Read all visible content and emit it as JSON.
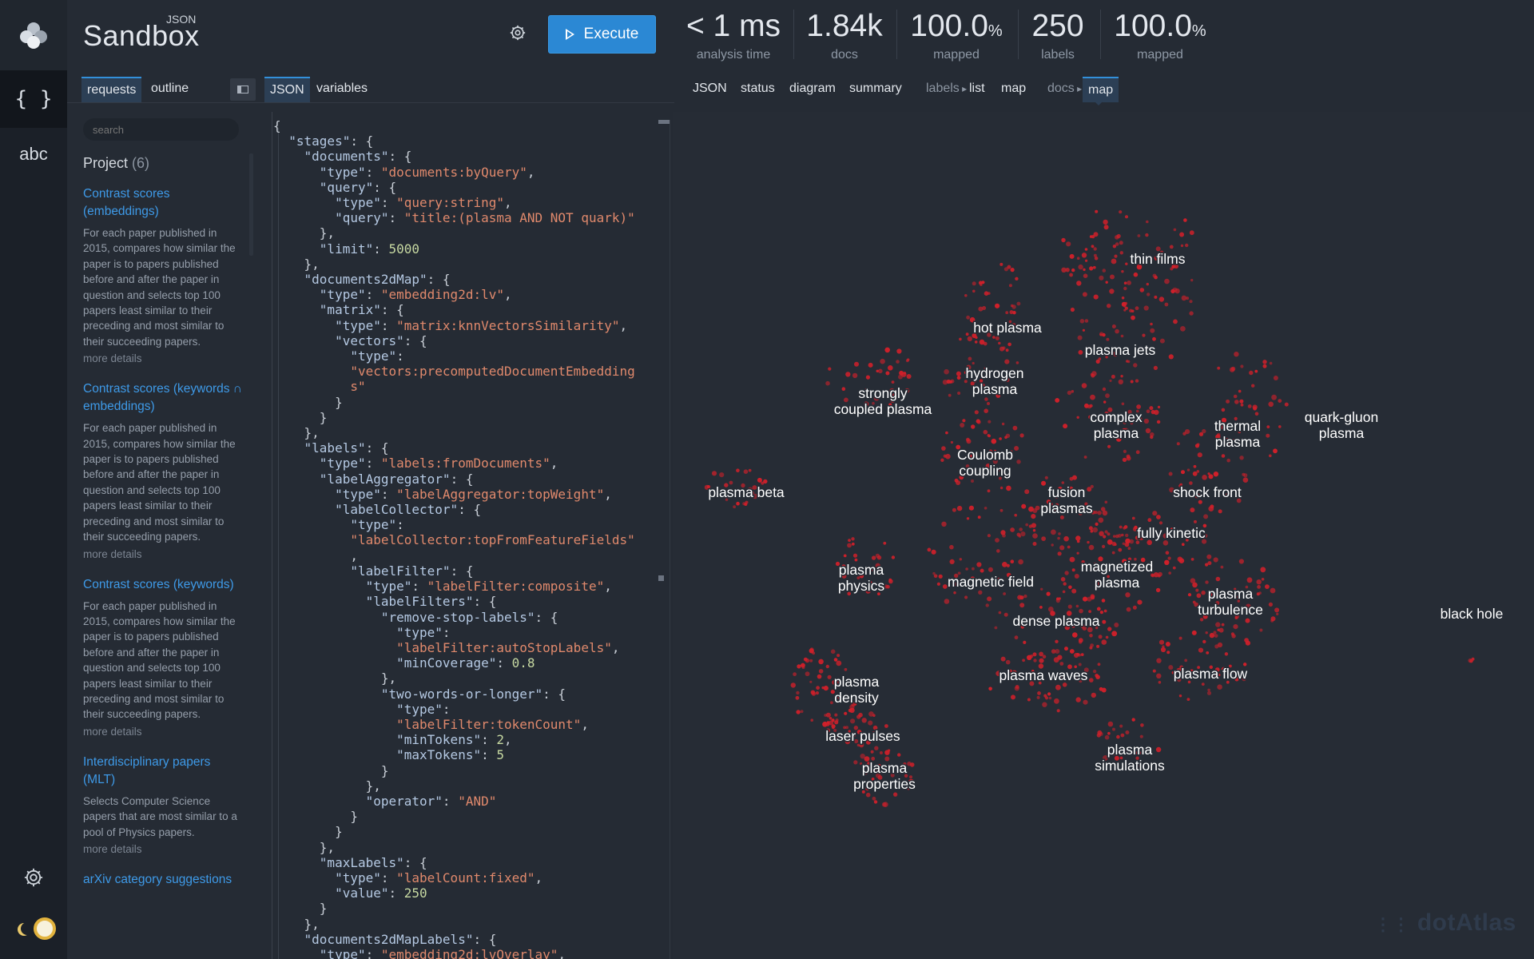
{
  "app": {
    "title": "Sandbox",
    "title_prefix": "JSON",
    "execute_label": "Execute"
  },
  "rail": {
    "json_label": "{ }",
    "abc_label": "abc"
  },
  "stats": [
    {
      "value": "< 1 ms",
      "unit": "",
      "label": "analysis time"
    },
    {
      "value": "1.84k",
      "unit": "",
      "label": "docs"
    },
    {
      "value": "100.0",
      "unit": "%",
      "label": "mapped"
    },
    {
      "value": "250",
      "unit": "",
      "label": "labels"
    },
    {
      "value": "100.0",
      "unit": "%",
      "label": "mapped"
    }
  ],
  "left_tabs": [
    "requests",
    "outline"
  ],
  "editor_tabs": [
    "JSON",
    "variables"
  ],
  "view_tabs": {
    "json": "JSON",
    "status": "status",
    "diagram": "diagram",
    "summary": "summary",
    "labels_prefix": "labels",
    "labels_list": "list",
    "labels_map": "map",
    "docs_prefix": "docs",
    "docs_map": "map"
  },
  "search": {
    "placeholder": "search"
  },
  "project": {
    "title": "Project",
    "count": "(6)"
  },
  "sidebar_items": [
    {
      "title": "Contrast scores (embeddings)",
      "desc": "For each paper published in 2015, compares how similar the paper is to papers published before and after the paper in question and selects top 100 papers least similar to their preceding and most similar to their succeeding papers.",
      "more": "more details"
    },
    {
      "title": "Contrast scores (keywords ∩ embeddings)",
      "desc": "For each paper published in 2015, compares how similar the paper is to papers published before and after the paper in question and selects top 100 papers least similar to their preceding and most similar to their succeeding papers.",
      "more": "more details"
    },
    {
      "title": "Contrast scores (keywords)",
      "desc": "For each paper published in 2015, compares how similar the paper is to papers published before and after the paper in question and selects top 100 papers least similar to their preceding and most similar to their succeeding papers.",
      "more": "more details"
    },
    {
      "title": "Interdisciplinary papers (MLT)",
      "desc": "Selects Computer Science papers that are most similar to a pool of Physics papers.",
      "more": "more details"
    },
    {
      "title": "arXiv category suggestions",
      "desc": "",
      "more": ""
    }
  ],
  "code_lines": [
    [
      [
        "p",
        "{"
      ]
    ],
    [
      [
        "p",
        "  "
      ],
      [
        "k",
        "\"stages\""
      ],
      [
        "p",
        ": {"
      ]
    ],
    [
      [
        "p",
        "    "
      ],
      [
        "k",
        "\"documents\""
      ],
      [
        "p",
        ": {"
      ]
    ],
    [
      [
        "p",
        "      "
      ],
      [
        "k",
        "\"type\""
      ],
      [
        "p",
        ": "
      ],
      [
        "s",
        "\"documents:byQuery\""
      ],
      [
        "p",
        ","
      ]
    ],
    [
      [
        "p",
        "      "
      ],
      [
        "k",
        "\"query\""
      ],
      [
        "p",
        ": {"
      ]
    ],
    [
      [
        "p",
        "        "
      ],
      [
        "k",
        "\"type\""
      ],
      [
        "p",
        ": "
      ],
      [
        "s",
        "\"query:string\""
      ],
      [
        "p",
        ","
      ]
    ],
    [
      [
        "p",
        "        "
      ],
      [
        "k",
        "\"query\""
      ],
      [
        "p",
        ": "
      ],
      [
        "s",
        "\"title:(plasma AND NOT quark)\""
      ]
    ],
    [
      [
        "p",
        "      },"
      ]
    ],
    [
      [
        "p",
        "      "
      ],
      [
        "k",
        "\"limit\""
      ],
      [
        "p",
        ": "
      ],
      [
        "n",
        "5000"
      ]
    ],
    [
      [
        "p",
        "    },"
      ]
    ],
    [
      [
        "p",
        "    "
      ],
      [
        "k",
        "\"documents2dMap\""
      ],
      [
        "p",
        ": {"
      ]
    ],
    [
      [
        "p",
        "      "
      ],
      [
        "k",
        "\"type\""
      ],
      [
        "p",
        ": "
      ],
      [
        "s",
        "\"embedding2d:lv\""
      ],
      [
        "p",
        ","
      ]
    ],
    [
      [
        "p",
        "      "
      ],
      [
        "k",
        "\"matrix\""
      ],
      [
        "p",
        ": {"
      ]
    ],
    [
      [
        "p",
        "        "
      ],
      [
        "k",
        "\"type\""
      ],
      [
        "p",
        ": "
      ],
      [
        "s",
        "\"matrix:knnVectorsSimilarity\""
      ],
      [
        "p",
        ","
      ]
    ],
    [
      [
        "p",
        "        "
      ],
      [
        "k",
        "\"vectors\""
      ],
      [
        "p",
        ": {"
      ]
    ],
    [
      [
        "p",
        "          "
      ],
      [
        "k",
        "\"type\""
      ],
      [
        "p",
        ":"
      ]
    ],
    [
      [
        "p",
        "          "
      ],
      [
        "s",
        "\"vectors:precomputedDocumentEmbedding"
      ]
    ],
    [
      [
        "p",
        "          "
      ],
      [
        "s",
        "s\""
      ]
    ],
    [
      [
        "p",
        "        }"
      ]
    ],
    [
      [
        "p",
        "      }"
      ]
    ],
    [
      [
        "p",
        "    },"
      ]
    ],
    [
      [
        "p",
        "    "
      ],
      [
        "k",
        "\"labels\""
      ],
      [
        "p",
        ": {"
      ]
    ],
    [
      [
        "p",
        "      "
      ],
      [
        "k",
        "\"type\""
      ],
      [
        "p",
        ": "
      ],
      [
        "s",
        "\"labels:fromDocuments\""
      ],
      [
        "p",
        ","
      ]
    ],
    [
      [
        "p",
        "      "
      ],
      [
        "k",
        "\"labelAggregator\""
      ],
      [
        "p",
        ": {"
      ]
    ],
    [
      [
        "p",
        "        "
      ],
      [
        "k",
        "\"type\""
      ],
      [
        "p",
        ": "
      ],
      [
        "s",
        "\"labelAggregator:topWeight\""
      ],
      [
        "p",
        ","
      ]
    ],
    [
      [
        "p",
        "        "
      ],
      [
        "k",
        "\"labelCollector\""
      ],
      [
        "p",
        ": {"
      ]
    ],
    [
      [
        "p",
        "          "
      ],
      [
        "k",
        "\"type\""
      ],
      [
        "p",
        ":"
      ]
    ],
    [
      [
        "p",
        "          "
      ],
      [
        "s",
        "\"labelCollector:topFromFeatureFields\""
      ]
    ],
    [
      [
        "p",
        "          ,"
      ]
    ],
    [
      [
        "p",
        "          "
      ],
      [
        "k",
        "\"labelFilter\""
      ],
      [
        "p",
        ": {"
      ]
    ],
    [
      [
        "p",
        "            "
      ],
      [
        "k",
        "\"type\""
      ],
      [
        "p",
        ": "
      ],
      [
        "s",
        "\"labelFilter:composite\""
      ],
      [
        "p",
        ","
      ]
    ],
    [
      [
        "p",
        "            "
      ],
      [
        "k",
        "\"labelFilters\""
      ],
      [
        "p",
        ": {"
      ]
    ],
    [
      [
        "p",
        "              "
      ],
      [
        "k",
        "\"remove-stop-labels\""
      ],
      [
        "p",
        ": {"
      ]
    ],
    [
      [
        "p",
        "                "
      ],
      [
        "k",
        "\"type\""
      ],
      [
        "p",
        ":"
      ]
    ],
    [
      [
        "p",
        "                "
      ],
      [
        "s",
        "\"labelFilter:autoStopLabels\""
      ],
      [
        "p",
        ","
      ]
    ],
    [
      [
        "p",
        "                "
      ],
      [
        "k",
        "\"minCoverage\""
      ],
      [
        "p",
        ": "
      ],
      [
        "n",
        "0.8"
      ]
    ],
    [
      [
        "p",
        "              },"
      ]
    ],
    [
      [
        "p",
        "              "
      ],
      [
        "k",
        "\"two-words-or-longer\""
      ],
      [
        "p",
        ": {"
      ]
    ],
    [
      [
        "p",
        "                "
      ],
      [
        "k",
        "\"type\""
      ],
      [
        "p",
        ":"
      ]
    ],
    [
      [
        "p",
        "                "
      ],
      [
        "s",
        "\"labelFilter:tokenCount\""
      ],
      [
        "p",
        ","
      ]
    ],
    [
      [
        "p",
        "                "
      ],
      [
        "k",
        "\"minTokens\""
      ],
      [
        "p",
        ": "
      ],
      [
        "n",
        "2"
      ],
      [
        "p",
        ","
      ]
    ],
    [
      [
        "p",
        "                "
      ],
      [
        "k",
        "\"maxTokens\""
      ],
      [
        "p",
        ": "
      ],
      [
        "n",
        "5"
      ]
    ],
    [
      [
        "p",
        "              }"
      ]
    ],
    [
      [
        "p",
        "            },"
      ]
    ],
    [
      [
        "p",
        "            "
      ],
      [
        "k",
        "\"operator\""
      ],
      [
        "p",
        ": "
      ],
      [
        "s",
        "\"AND\""
      ]
    ],
    [
      [
        "p",
        "          }"
      ]
    ],
    [
      [
        "p",
        "        }"
      ]
    ],
    [
      [
        "p",
        "      },"
      ]
    ],
    [
      [
        "p",
        "      "
      ],
      [
        "k",
        "\"maxLabels\""
      ],
      [
        "p",
        ": {"
      ]
    ],
    [
      [
        "p",
        "        "
      ],
      [
        "k",
        "\"type\""
      ],
      [
        "p",
        ": "
      ],
      [
        "s",
        "\"labelCount:fixed\""
      ],
      [
        "p",
        ","
      ]
    ],
    [
      [
        "p",
        "        "
      ],
      [
        "k",
        "\"value\""
      ],
      [
        "p",
        ": "
      ],
      [
        "n",
        "250"
      ]
    ],
    [
      [
        "p",
        "      }"
      ]
    ],
    [
      [
        "p",
        "    },"
      ]
    ],
    [
      [
        "p",
        "    "
      ],
      [
        "k",
        "\"documents2dMapLabels\""
      ],
      [
        "p",
        ": {"
      ]
    ],
    [
      [
        "p",
        "      "
      ],
      [
        "k",
        "\"type\""
      ],
      [
        "p",
        ": "
      ],
      [
        "s",
        "\"embedding2d:lvOverlay\""
      ],
      [
        "p",
        ","
      ]
    ]
  ],
  "map_labels": [
    "thin films",
    "hot plasma",
    "plasma jets",
    "hydrogen|plasma",
    "strongly|coupled plasma",
    "complex|plasma",
    "thermal|plasma",
    "quark-gluon|plasma",
    "Coulomb|coupling",
    "plasma beta",
    "fusion|plasmas",
    "shock front",
    "fully kinetic",
    "plasma|physics",
    "magnetic field",
    "magnetized|plasma",
    "plasma|turbulence",
    "black hole",
    "dense plasma",
    "plasma|density",
    "plasma waves",
    "plasma flow",
    "laser pulses",
    "plasma|simulations",
    "plasma|properties"
  ],
  "watermark": "dotAtlas",
  "colors": {
    "accent": "#2b88d4",
    "dots": "#d0202a",
    "link": "#3e9ae8"
  }
}
